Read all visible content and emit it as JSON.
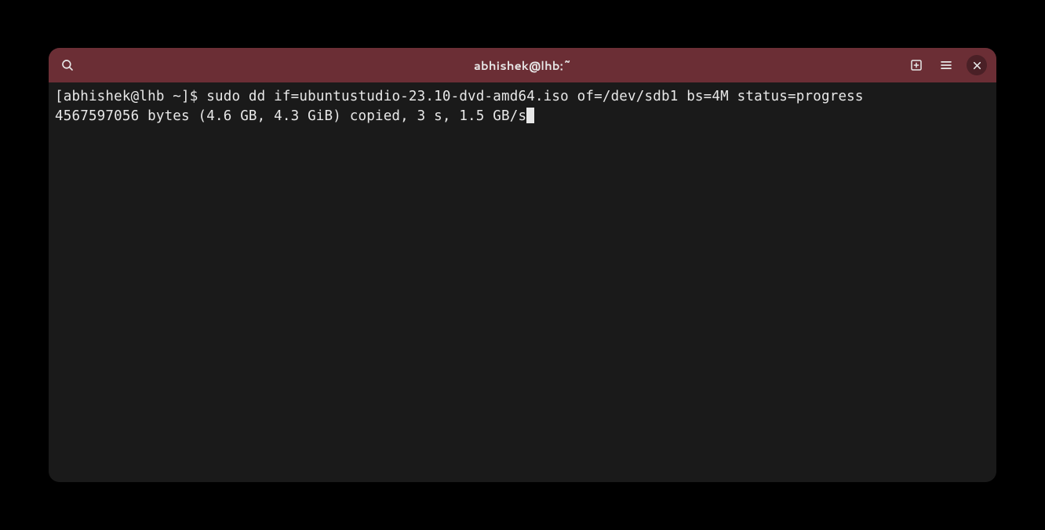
{
  "titlebar": {
    "title": "abhishek@lhb:~"
  },
  "terminal": {
    "prompt": "[abhishek@lhb ~]$ ",
    "command": "sudo dd if=ubuntustudio-23.10-dvd-amd64.iso of=/dev/sdb1 bs=4M status=progress",
    "output_line": "4567597056 bytes (4.6 GB, 4.3 GiB) copied, 3 s, 1.5 GB/s"
  }
}
